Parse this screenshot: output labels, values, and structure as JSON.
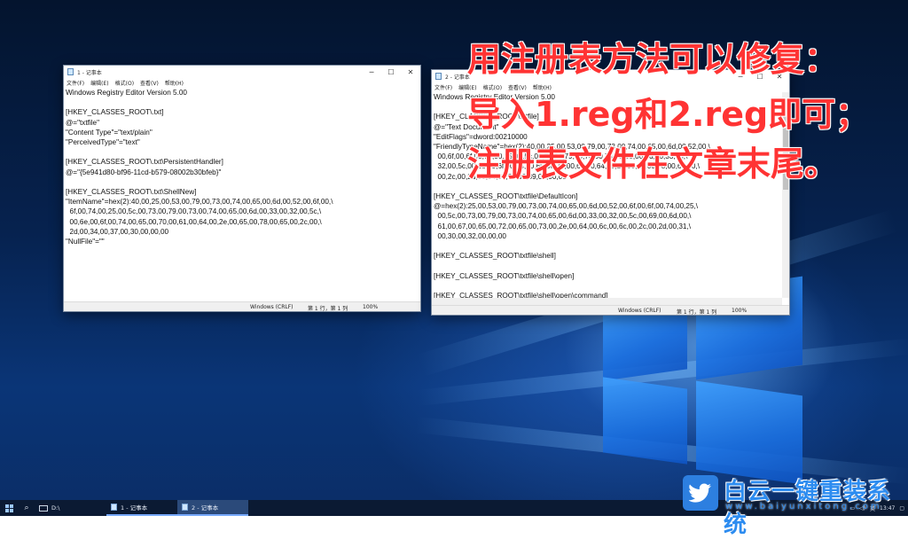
{
  "colors": {
    "overlay_red": "#ff3333",
    "watermark_blue": "#2d8cf0",
    "taskbar": "#0b1a33"
  },
  "window1": {
    "title": "1 - 记事本",
    "menu": [
      "文件(F)",
      "编辑(E)",
      "格式(O)",
      "查看(V)",
      "帮助(H)"
    ],
    "content": "Windows Registry Editor Version 5.00\n\n[HKEY_CLASSES_ROOT\\.txt]\n@=\"txtfile\"\n\"Content Type\"=\"text/plain\"\n\"PerceivedType\"=\"text\"\n\n[HKEY_CLASSES_ROOT\\.txt\\PersistentHandler]\n@=\"{5e941d80-bf96-11cd-b579-08002b30bfeb}\"\n\n[HKEY_CLASSES_ROOT\\.txt\\ShellNew]\n\"ItemName\"=hex(2):40,00,25,00,53,00,79,00,73,00,74,00,65,00,6d,00,52,00,6f,00,\\\n  6f,00,74,00,25,00,5c,00,73,00,79,00,73,00,74,00,65,00,6d,00,33,00,32,00,5c,\\\n  00,6e,00,6f,00,74,00,65,00,70,00,61,00,64,00,2e,00,65,00,78,00,65,00,2c,00,\\\n  2d,00,34,00,37,00,30,00,00,00\n\"NullFile\"=\"\"",
    "status": {
      "encoding": "Windows (CRLF)",
      "position": "第 1 行，第 1 列",
      "zoom": "100%"
    }
  },
  "window2": {
    "title": "2 - 记事本",
    "menu": [
      "文件(F)",
      "编辑(E)",
      "格式(O)",
      "查看(V)",
      "帮助(H)"
    ],
    "content": "Windows Registry Editor Version 5.00\n\n[HKEY_CLASSES_ROOT\\txtfile]\n@=\"Text Document\"\n\"EditFlags\"=dword:00210000\n\"FriendlyTypeName\"=hex(2):40,00,25,00,53,00,79,00,73,00,74,00,65,00,6d,00,52,00,\\\n  00,6f,00,6f,00,74,00,25,00,5c,00,73,00,79,00,73,00,74,00,65,00,6d,00,33,00,\\\n  32,00,5c,00,6e,00,6f,00,74,00,65,00,70,00,61,00,64,00,2e,00,65,00,78,00,65,00,\\\n  00,2c,00,2d,00,34,00,36,00,39,00,00,00\n\n[HKEY_CLASSES_ROOT\\txtfile\\DefaultIcon]\n@=hex(2):25,00,53,00,79,00,73,00,74,00,65,00,6d,00,52,00,6f,00,6f,00,74,00,25,\\\n  00,5c,00,73,00,79,00,73,00,74,00,65,00,6d,00,33,00,32,00,5c,00,69,00,6d,00,\\\n  61,00,67,00,65,00,72,00,65,00,73,00,2e,00,64,00,6c,00,6c,00,2c,00,2d,00,31,\\\n  00,30,00,32,00,00,00\n\n[HKEY_CLASSES_ROOT\\txtfile\\shell]\n\n[HKEY_CLASSES_ROOT\\txtfile\\shell\\open]\n\n[HKEY_CLASSES_ROOT\\txtfile\\shell\\open\\command]",
    "status": {
      "encoding": "Windows (CRLF)",
      "position": "第 1 行，第 1 列",
      "zoom": "100%"
    }
  },
  "overlay": {
    "line1": "用注册表方法可以修复：",
    "line2": "导入1.reg和2.reg即可；",
    "line3": "注册表文件在文章末尾。"
  },
  "taskbar": {
    "folder_label": "D:\\",
    "app1_label": "1 - 记事本",
    "app2_label": "2 - 记事本",
    "tray_ime": "英",
    "tray_time": "13:47"
  },
  "watermark": {
    "brand": "白云一键重装系统",
    "url": "www.baiyunxitong.com"
  }
}
